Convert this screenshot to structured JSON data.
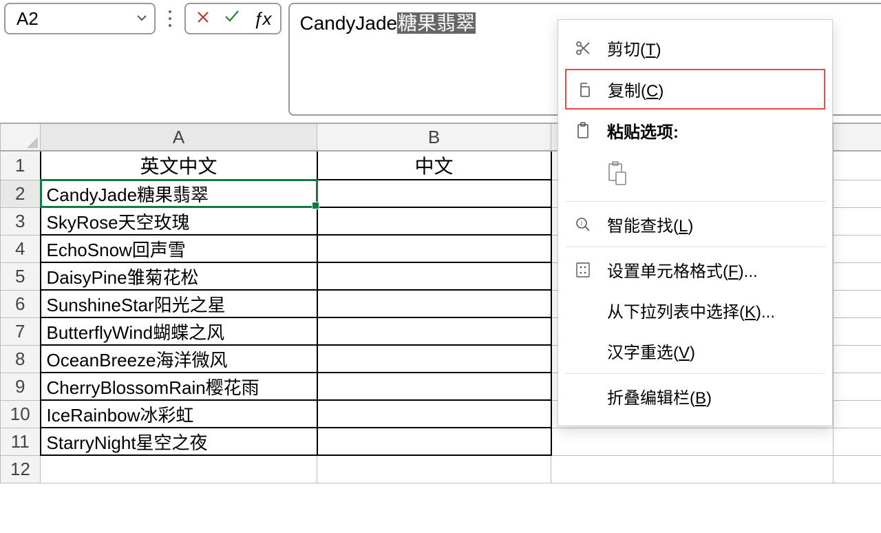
{
  "formula_bar": {
    "cell_ref": "A2",
    "formula_plain": "CandyJade",
    "formula_selected": "糖果翡翠"
  },
  "columns": {
    "A": "A",
    "B": "B"
  },
  "rows": [
    {
      "n": "1",
      "A": "英文中文",
      "B": "中文"
    },
    {
      "n": "2",
      "A": "CandyJade糖果翡翠",
      "B": ""
    },
    {
      "n": "3",
      "A": "SkyRose天空玫瑰",
      "B": ""
    },
    {
      "n": "4",
      "A": "EchoSnow回声雪",
      "B": ""
    },
    {
      "n": "5",
      "A": "DaisyPine雏菊花松",
      "B": ""
    },
    {
      "n": "6",
      "A": "SunshineStar阳光之星",
      "B": ""
    },
    {
      "n": "7",
      "A": "ButterflyWind蝴蝶之风",
      "B": ""
    },
    {
      "n": "8",
      "A": "OceanBreeze海洋微风",
      "B": ""
    },
    {
      "n": "9",
      "A": "CherryBlossomRain樱花雨",
      "B": ""
    },
    {
      "n": "10",
      "A": "IceRainbow冰彩虹",
      "B": ""
    },
    {
      "n": "11",
      "A": "StarryNight星空之夜",
      "B": ""
    },
    {
      "n": "12",
      "A": "",
      "B": ""
    }
  ],
  "context_menu": {
    "cut": {
      "label": "剪切",
      "accel": "T"
    },
    "copy": {
      "label": "复制",
      "accel": "C"
    },
    "paste_options": {
      "label": "粘贴选项:"
    },
    "smart_lookup": {
      "label": "智能查找",
      "accel": "L"
    },
    "format_cells": {
      "label": "设置单元格格式",
      "accel": "F",
      "suffix": "..."
    },
    "pick_list": {
      "label": "从下拉列表中选择",
      "accel": "K",
      "suffix": "..."
    },
    "reconvert": {
      "label": "汉字重选",
      "accel": "V"
    },
    "collapse_bar": {
      "label": "折叠编辑栏",
      "accel": "B"
    }
  }
}
